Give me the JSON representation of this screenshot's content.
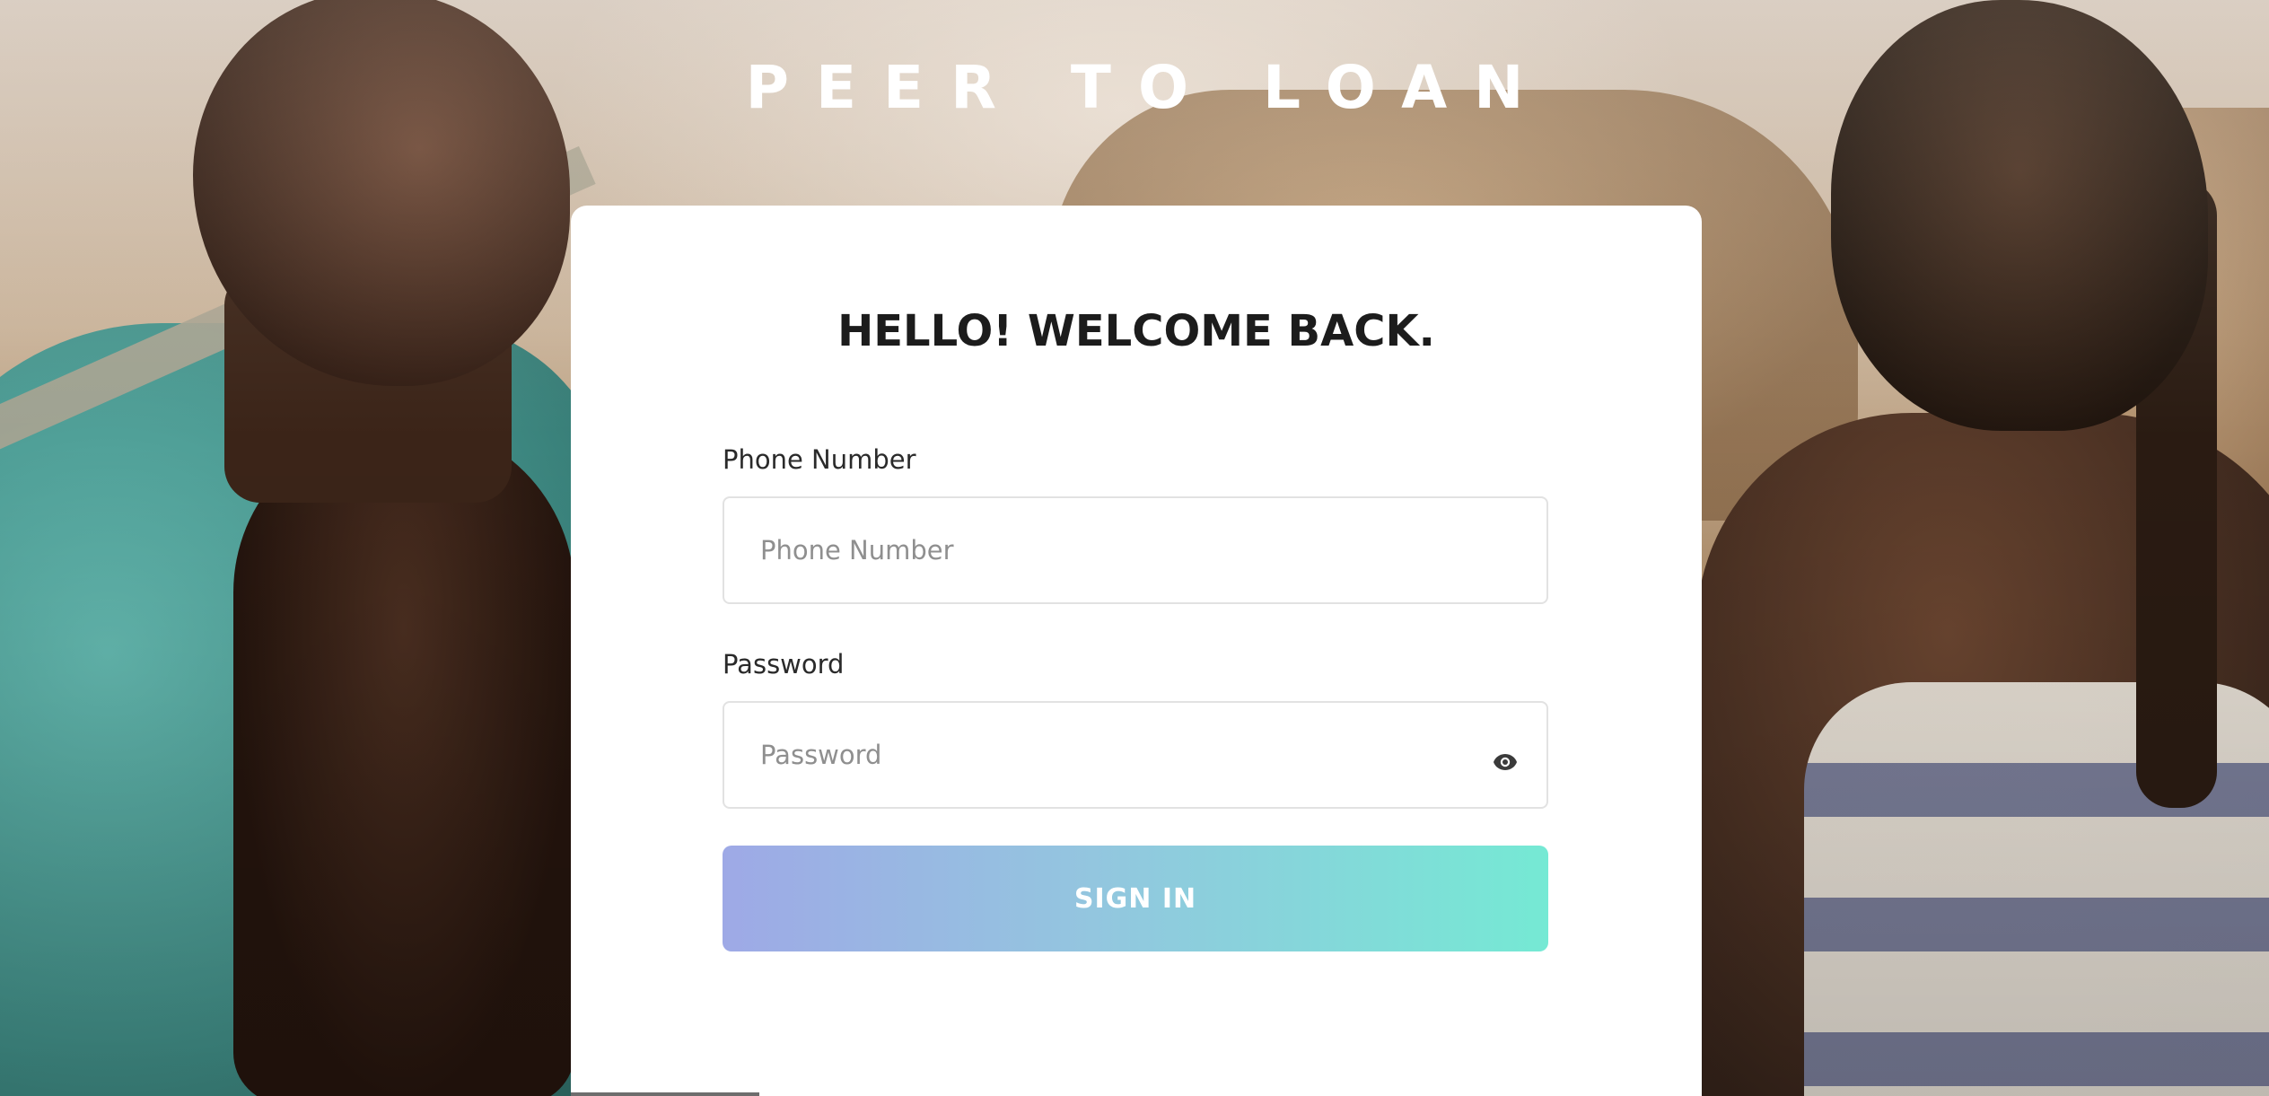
{
  "brand": {
    "title": "PEER TO LOAN"
  },
  "login": {
    "heading": "HELLO! WELCOME BACK.",
    "phone": {
      "label": "Phone Number",
      "placeholder": "Phone Number",
      "value": ""
    },
    "password": {
      "label": "Password",
      "placeholder": "Password",
      "value": "",
      "toggle_icon": "eye-icon"
    },
    "submit_label": "SIGN IN"
  },
  "colors": {
    "button_gradient_start": "#9ea9e6",
    "button_gradient_end": "#75e9d4",
    "card_background": "#ffffff",
    "heading_text": "#1c1c1c"
  }
}
